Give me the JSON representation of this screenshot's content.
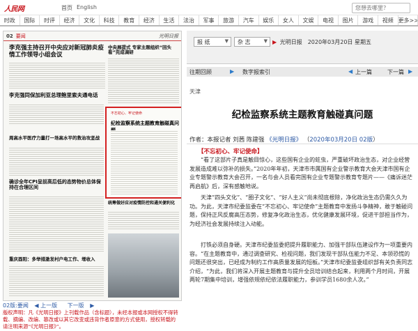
{
  "top": {
    "logo": "人民网",
    "home": "首页",
    "english": "English",
    "search_placeholder": "您想去哪里？"
  },
  "nav": [
    "时政",
    "国际",
    "时评",
    "经济",
    "文化",
    "科技",
    "教育",
    "经济",
    "生活",
    "法治",
    "军事",
    "旅游",
    "汽车",
    "娱乐",
    "女人",
    "文娱",
    "电视",
    "图片",
    "游戏",
    "视频",
    "更多>>"
  ],
  "paper": {
    "page_num": "02",
    "page_title": "要闻",
    "masthead": "光明日报",
    "story1": "李克强主持召开中央应对新冠肺炎疫情工作领导小组会议",
    "story2": "中央展提式 专家主题组织“回头看”完成调研",
    "story3": "李克强同保加利亚总理鲍里索夫通电话",
    "story4": "周高水平医疗力量打一场高水平的救治攻坚战",
    "story5": "确诊全年CPI呈前高后低的态势物价总体保持在合理区间",
    "story6": "重庆酉阳：多举措激发村户电工作、增收入",
    "story7": "统筹做好应对疫情防控和通关便利化",
    "highlight_kicker": "不忘初心、牢记使命",
    "highlight_title": "纪检监察系统主题教育触碰真问题"
  },
  "pager": {
    "page": "02版:要闻",
    "prev": "上一版",
    "next": "下一版"
  },
  "copyright": "版权声明：凡《光明日报》上刊载作品（含标题），未经本报或本网授权不得转载、摘编、改编、篡改或以其它改变或违背作者原意的方式使用，授权转载的请注明来源“《光明日报》”。",
  "selectors": {
    "paper": "报 纸",
    "date_type": "杂 志",
    "date_text": "光明日报　2020年03月20日  星期五"
  },
  "subnav": {
    "prev_issue": "往期回顾",
    "digital": "数字报索引",
    "prev": "上一篇",
    "next": "下一篇"
  },
  "article": {
    "source": "天津",
    "title": "纪检监察系统主题教育触碰真问题",
    "author_label": "作者：本报记者 刘茜 陈建强",
    "source_name": "《光明日报》",
    "date": "2020年03月20日",
    "page": "02版",
    "subhead": "【不忘初心、牢记使命】",
    "p1": "“看了这部片子真是触目惊心，这些国有企业的蛀虫，严重破坏政治生态，对企业经营发展造成难以弥补的损失。”2020年年初，天津市市属国有企业警示教育大会天津市国有企业专题警示教育大会召开，一名与会人员看完国有企业专题警示教育专题片——《痛诉迷茫再启航》后，深有感触地说。",
    "p2": "天津“四头文化”、“圈子文化”、“好人主义”尚未彻底根除，净化政治生态仍需久久为功。为此，天津市纪委监委在“不忘初心、牢记使命”主题教育中发扬斗争精神，敢于触碰问题，保持正风反腐高压态势，修复净化政治生态，优化健康发展环境，促进干部担当作为，为经济社会发展持续注入动能。",
    "p3": "打铁必须自身硬。天津市纪委监委把提升履职能力、加强干部队伍建设作为一项重要内容。“在主题教育中，通过调查研究、检视问题，我们发现干部队伍能力不足、本领恐慌的问题还很突出，已经成为制约工作高质量发展的短板。”天津市纪委监委组织部有关负责同志介绍，“为此，我们将深入开展主题教育与提升全员培训结合起来，利用两个月时间，开展两轮7期集中培训，增强依规依纪依法履职能力，参训学员1680余人次。”"
  }
}
